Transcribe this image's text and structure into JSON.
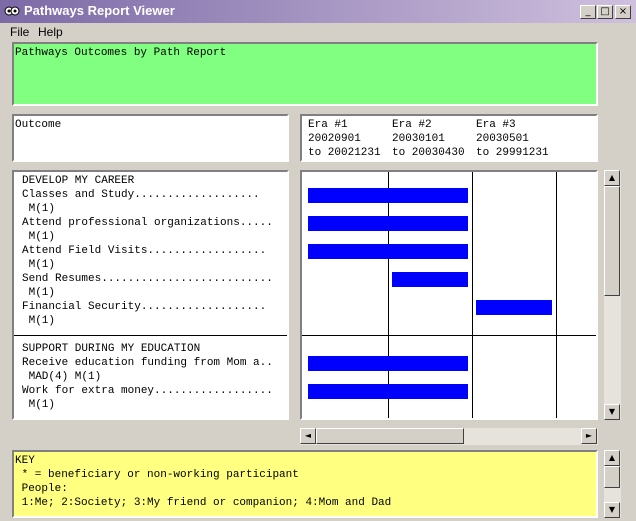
{
  "window": {
    "title": "Pathways Report Viewer",
    "buttons": {
      "minimize": "_",
      "maximize": "□",
      "close": "×"
    }
  },
  "menu": [
    "File",
    "Help"
  ],
  "report_title": "Pathways Outcomes by Path Report",
  "outcome_header": "Outcome",
  "eras": [
    {
      "name": "Era #1",
      "start": "20020901",
      "end": "to 20021231"
    },
    {
      "name": "Era #2",
      "start": "20030101",
      "end": "to 20030430"
    },
    {
      "name": "Era #3",
      "start": "20030501",
      "end": "to 29991231"
    }
  ],
  "outcome_lines": [
    "DEVELOP MY CAREER",
    "Classes and Study...................",
    " M(1)",
    "Attend professional organizations.....",
    " M(1)",
    "Attend Field Visits..................",
    " M(1)",
    "Send Resumes..........................",
    " M(1)",
    "Financial Security...................",
    " M(1)",
    "",
    "SUPPORT DURING MY EDUCATION",
    "Receive education funding from Mom a..",
    " MAD(4) M(1)",
    "Work for extra money..................",
    " M(1)"
  ],
  "bars": [
    {
      "row": 1,
      "from_era": 1,
      "to_era": 2
    },
    {
      "row": 3,
      "from_era": 1,
      "to_era": 2
    },
    {
      "row": 5,
      "from_era": 1,
      "to_era": 2
    },
    {
      "row": 7,
      "from_era": 2,
      "to_era": 2
    },
    {
      "row": 9,
      "from_era": 3,
      "to_era": 3
    },
    {
      "row": 13,
      "from_era": 1,
      "to_era": 2
    },
    {
      "row": 15,
      "from_era": 1,
      "to_era": 2
    }
  ],
  "section_divider_row": 11.5,
  "key_lines": [
    "KEY",
    " * = beneficiary or non-working participant",
    " People:",
    " 1:Me; 2:Society; 3:My friend or companion; 4:Mom and Dad"
  ],
  "scrollbar_arrows": {
    "up": "▲",
    "down": "▼",
    "left": "◄",
    "right": "►"
  }
}
